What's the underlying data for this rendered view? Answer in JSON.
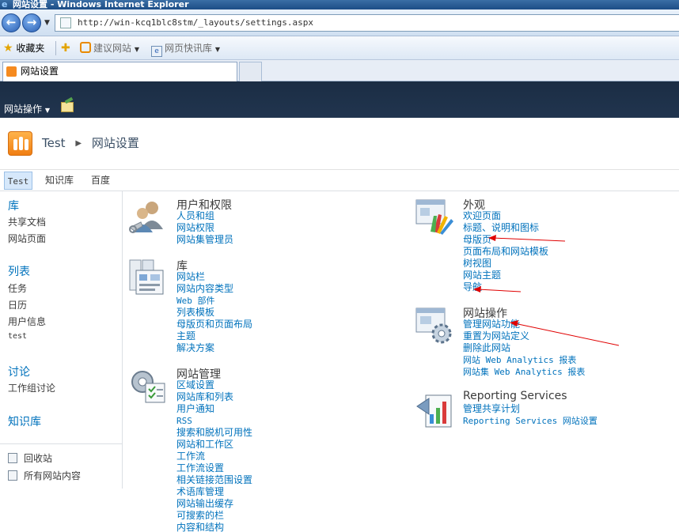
{
  "browser": {
    "window_title": "网站设置 - Windows Internet Explorer",
    "url": "http://win-kcq1blc8stm/_layouts/settings.aspx",
    "favorites_label": "收藏夹",
    "fav_items": [
      "建议网站",
      "网页快讯库"
    ],
    "tab_title": "网站设置"
  },
  "sharepoint": {
    "site_actions_label": "网站操作",
    "breadcrumb": {
      "site": "Test",
      "page": "网站设置"
    },
    "topnav": [
      "Test",
      "知识库",
      "百度"
    ]
  },
  "quicklaunch": {
    "sections": [
      {
        "heading": "库",
        "items": [
          "共享文档",
          "网站页面"
        ]
      },
      {
        "heading": "列表",
        "items": [
          "任务",
          "日历",
          "用户信息",
          "test"
        ]
      },
      {
        "heading": "讨论",
        "items": [
          "工作组讨论"
        ]
      },
      {
        "heading": "知识库",
        "items": []
      }
    ],
    "bottom": [
      "回收站",
      "所有网站内容"
    ]
  },
  "groups": {
    "users": {
      "title": "用户和权限",
      "links": [
        "人员和组",
        "网站权限",
        "网站集管理员"
      ]
    },
    "galleries": {
      "title": "库",
      "links": [
        "网站栏",
        "网站内容类型",
        "Web 部件",
        "列表模板",
        "母版页和页面布局",
        "主题",
        "解决方案"
      ]
    },
    "admin": {
      "title": "网站管理",
      "links": [
        "区域设置",
        "网站库和列表",
        "用户通知",
        "RSS",
        "搜索和脱机可用性",
        "网站和工作区",
        "工作流",
        "工作流设置",
        "相关链接范围设置",
        "术语库管理",
        "网站输出缓存",
        "可搜索的栏",
        "内容和结构"
      ]
    },
    "look": {
      "title": "外观",
      "links": [
        "欢迎页面",
        "标题、说明和图标",
        "母版页",
        "页面布局和网站模板",
        "树视图",
        "网站主题",
        "导航"
      ]
    },
    "actions": {
      "title": "网站操作",
      "links": [
        "管理网站功能",
        "重置为网站定义",
        "删除此网站",
        "网站 Web Analytics 报表",
        "网站集 Web Analytics 报表"
      ]
    },
    "reporting": {
      "title": "Reporting Services",
      "links": [
        "管理共享计划",
        "Reporting Services 网站设置"
      ]
    }
  },
  "colors": {
    "link": "#0072bc",
    "ribbon": "#1b2d44",
    "annotation": "#e00000"
  }
}
